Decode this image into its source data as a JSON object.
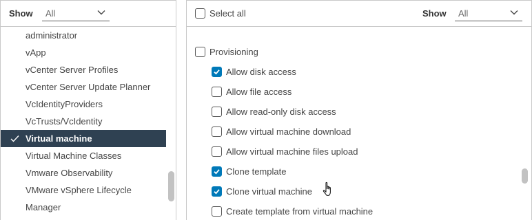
{
  "left": {
    "show_label": "Show",
    "show_value": "All",
    "items": [
      {
        "label": "administrator"
      },
      {
        "label": "vApp"
      },
      {
        "label": "vCenter Server Profiles"
      },
      {
        "label": "vCenter Server Update Planner"
      },
      {
        "label": "VcIdentityProviders"
      },
      {
        "label": "VcTrusts/VcIdentity"
      },
      {
        "label": "Virtual machine",
        "selected": true
      },
      {
        "label": "Virtual Machine Classes"
      },
      {
        "label": "Vmware Observability"
      },
      {
        "label": "VMware vSphere Lifecycle"
      },
      {
        "label": "Manager"
      }
    ]
  },
  "right": {
    "select_all_label": "Select all",
    "select_all_checked": false,
    "show_label": "Show",
    "show_value": "All",
    "group": {
      "label": "Provisioning",
      "checked": false
    },
    "privileges": [
      {
        "label": "Allow disk access",
        "checked": true
      },
      {
        "label": "Allow file access",
        "checked": false
      },
      {
        "label": "Allow read-only disk access",
        "checked": false
      },
      {
        "label": "Allow virtual machine download",
        "checked": false
      },
      {
        "label": "Allow virtual machine files upload",
        "checked": false
      },
      {
        "label": "Clone template",
        "checked": true
      },
      {
        "label": "Clone virtual machine",
        "checked": true
      },
      {
        "label": "Create template from virtual machine",
        "checked": false
      }
    ]
  },
  "colors": {
    "accent": "#0079b8",
    "selected_bg": "#2f4152"
  },
  "icons": {
    "selected_check": "checkmark-icon",
    "dropdown": "chevron-down-icon",
    "cursor": "hand-pointer-icon"
  }
}
